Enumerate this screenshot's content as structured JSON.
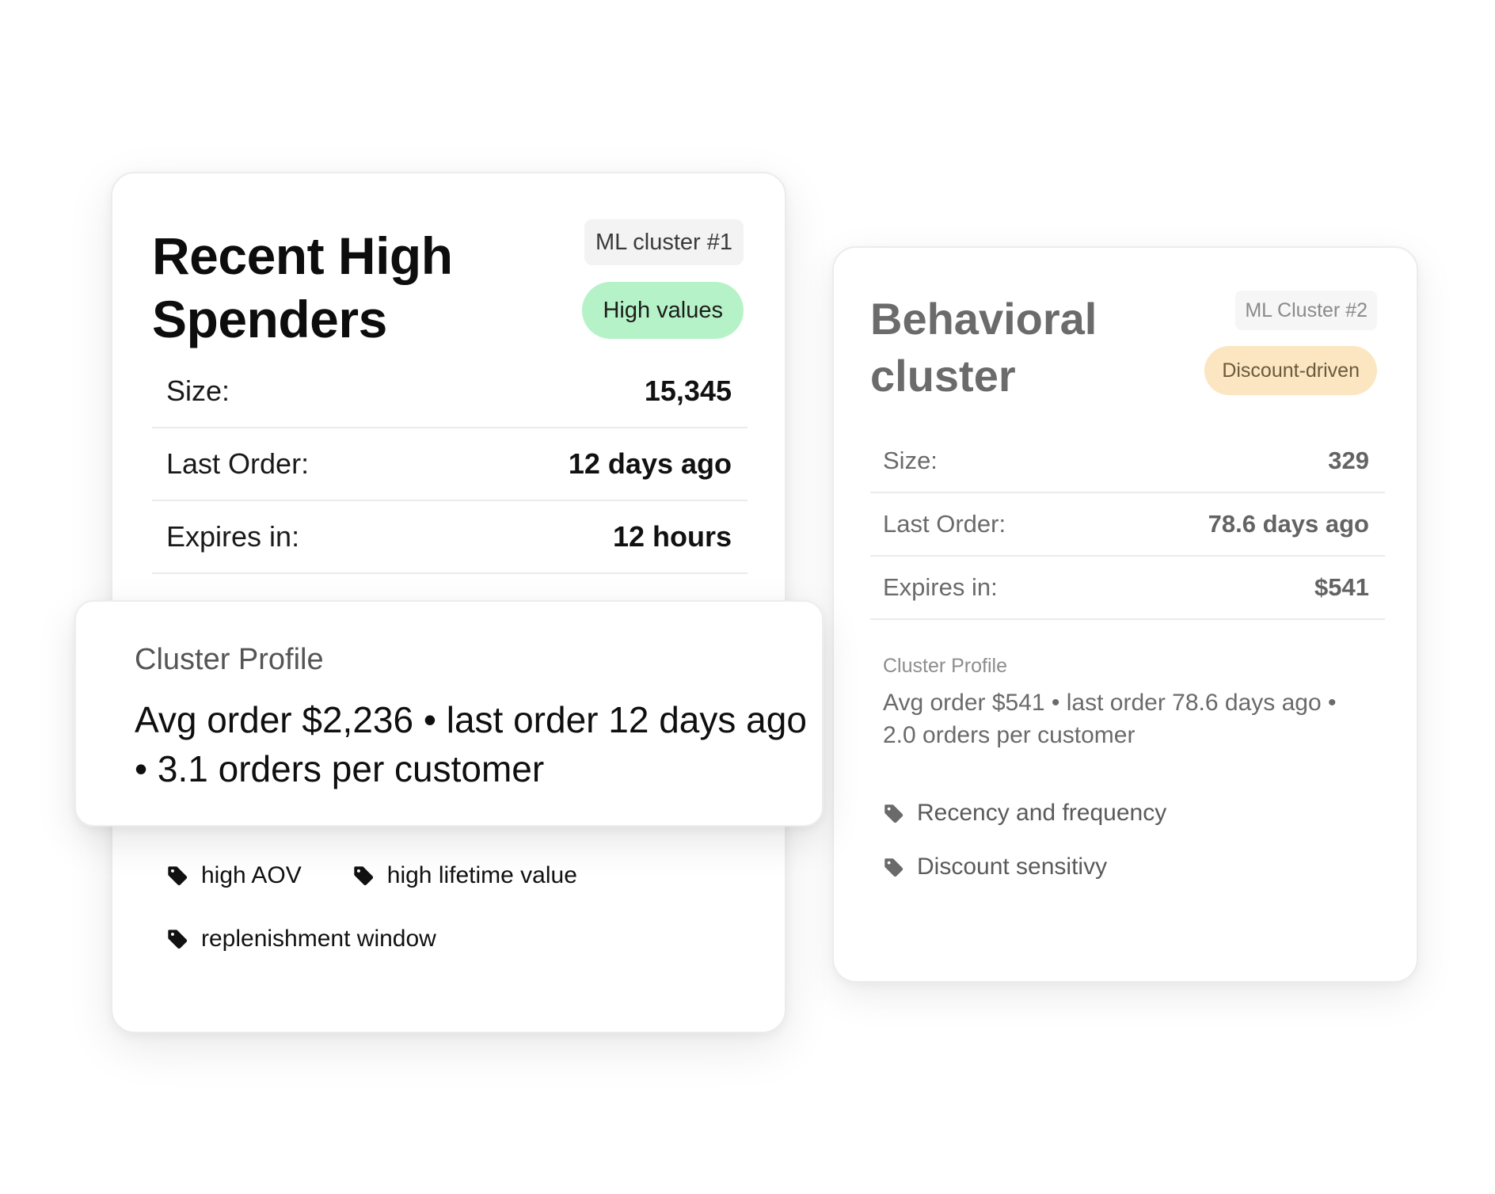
{
  "cluster1": {
    "title": "Recent High Spenders",
    "cluster_chip": "ML cluster #1",
    "value_chip": "High values",
    "stats": [
      {
        "label": "Size:",
        "value": "15,345"
      },
      {
        "label": "Last Order:",
        "value": "12 days ago"
      },
      {
        "label": "Expires in:",
        "value": "12 hours"
      }
    ],
    "profile_label": "Cluster Profile",
    "profile_text": "Avg order $2,236 • last order 12 days ago • 3.1 orders per customer",
    "tags": [
      "high AOV",
      "high lifetime value",
      "replenishment window"
    ]
  },
  "cluster2": {
    "title": "Behavioral cluster",
    "cluster_chip": "ML Cluster #2",
    "value_chip": "Discount-driven",
    "stats": [
      {
        "label": "Size:",
        "value": "329"
      },
      {
        "label": "Last Order:",
        "value": "78.6 days ago"
      },
      {
        "label": "Expires in:",
        "value": "$541"
      }
    ],
    "profile_label": "Cluster Profile",
    "profile_text": "Avg order $541 • last order 78.6 days ago • 2.0 orders per customer",
    "tags": [
      "Recency and frequency",
      "Discount sensitivy"
    ]
  },
  "icons": {
    "tag": "tag-icon"
  },
  "colors": {
    "high_values_chip": "#b6f2c7",
    "discount_chip": "#fbe6c1",
    "chip_neutral": "#f3f3f3"
  }
}
